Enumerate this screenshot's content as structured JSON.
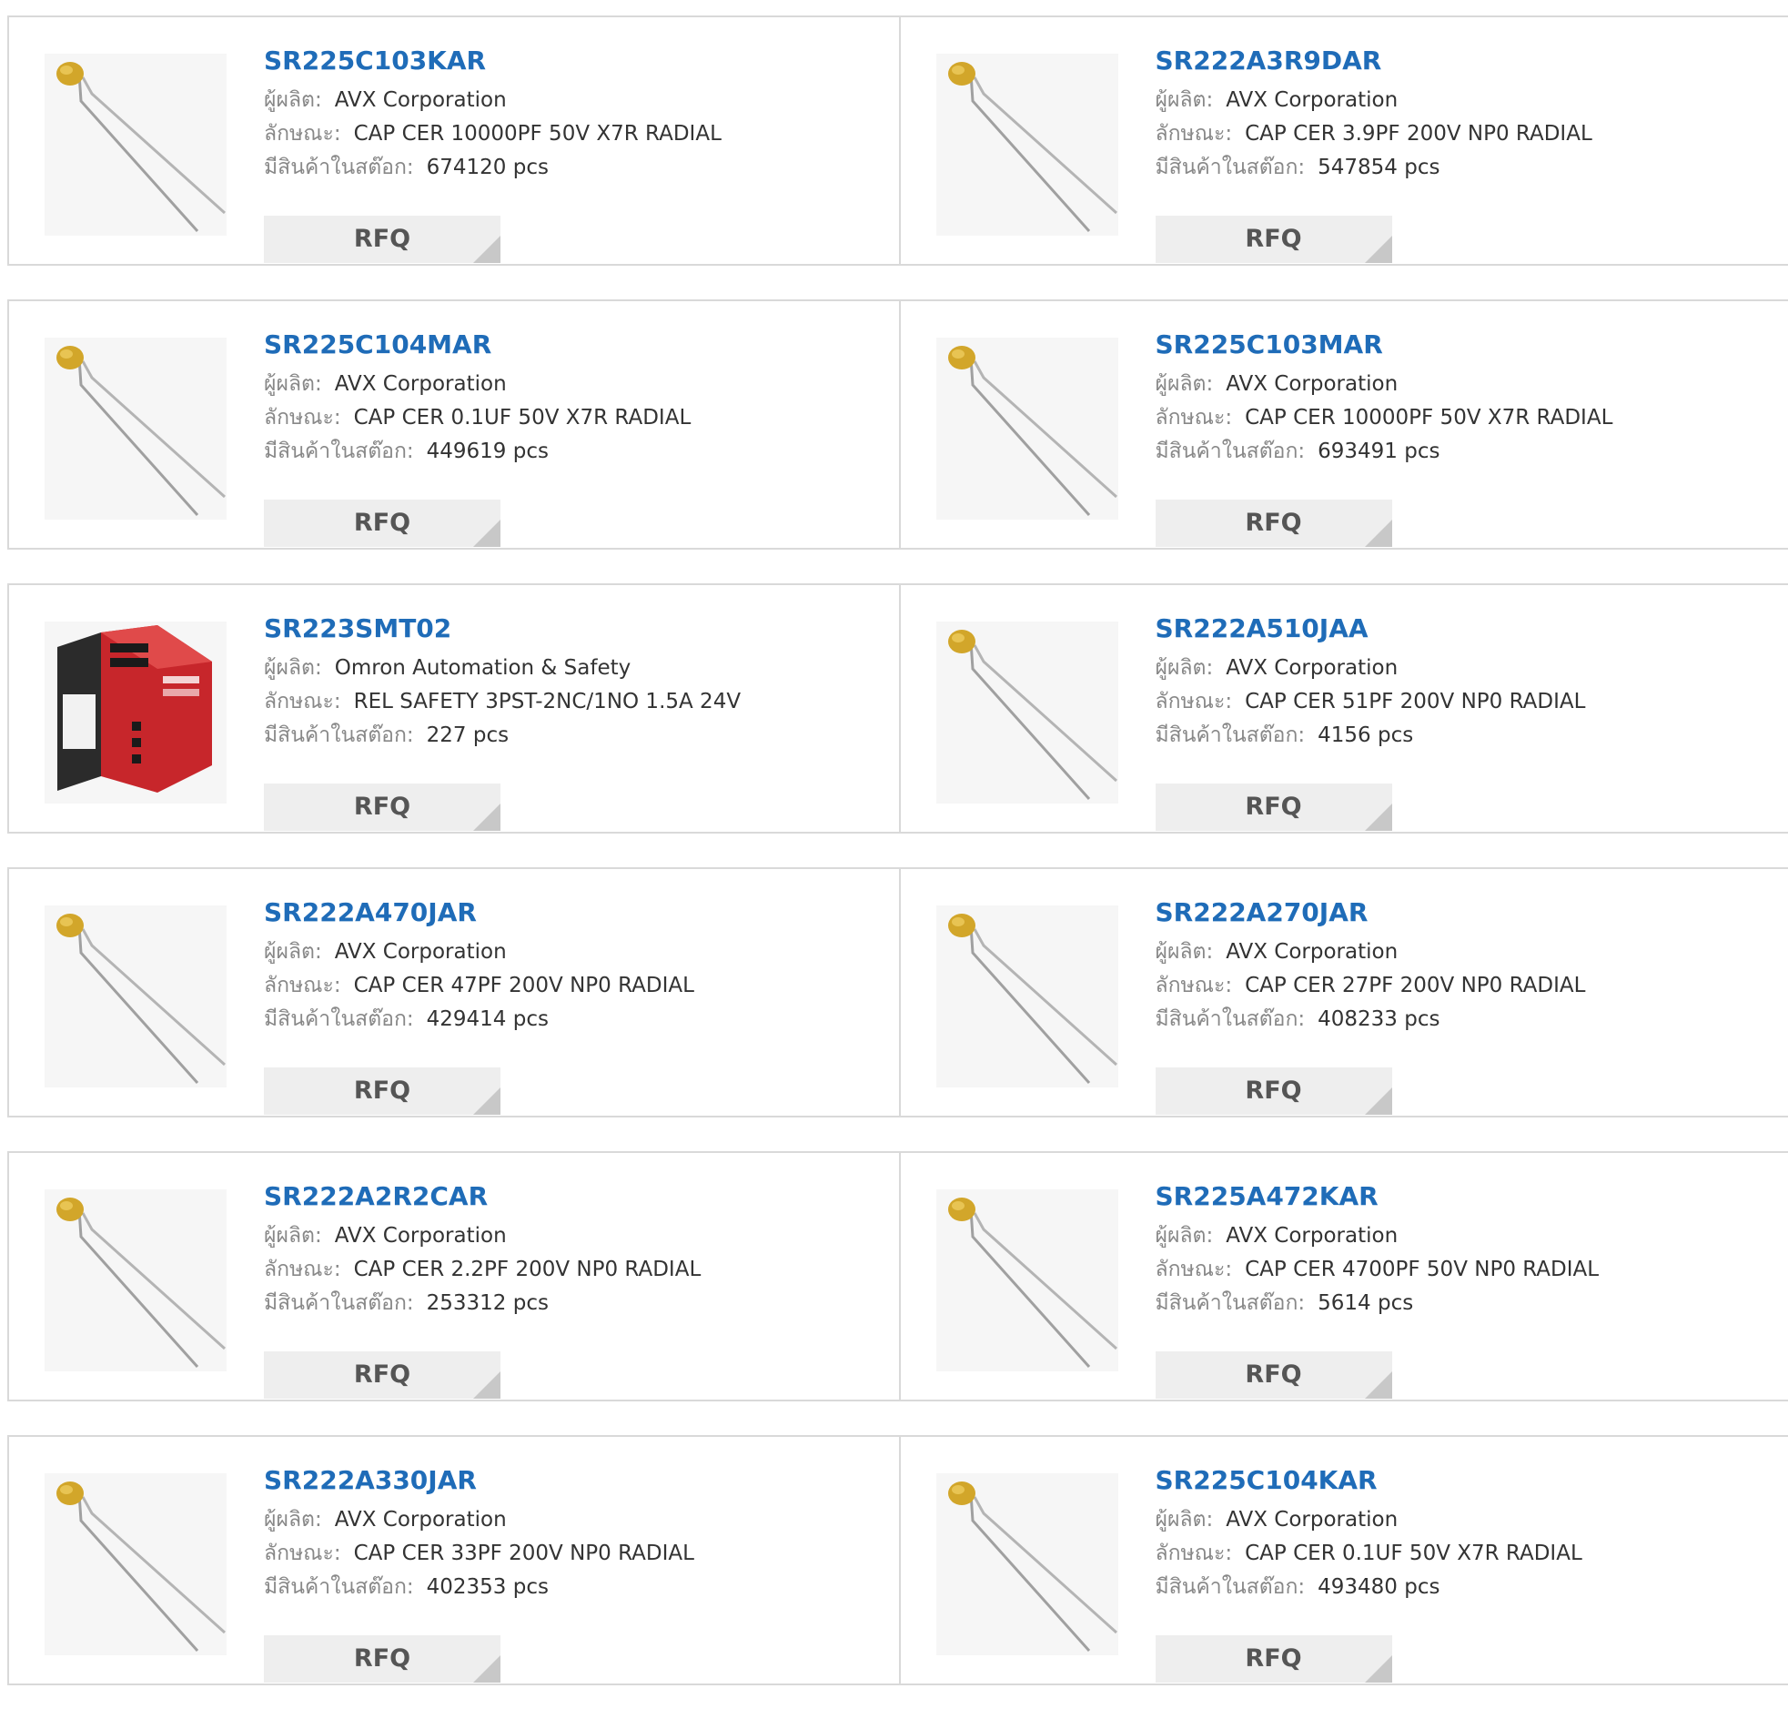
{
  "labels": {
    "manufacturer": "ผู้ผลิต:",
    "description": "ลักษณะ:",
    "stock": "มีสินค้าในสต๊อก:",
    "rfq": "RFQ"
  },
  "products": [
    {
      "part": "SR225C103KAR",
      "manufacturer": "AVX Corporation",
      "description": "CAP CER 10000PF 50V X7R RADIAL",
      "stock": "674120 pcs",
      "image": "radial-capacitor-icon"
    },
    {
      "part": "SR222A3R9DAR",
      "manufacturer": "AVX Corporation",
      "description": "CAP CER 3.9PF 200V NP0 RADIAL",
      "stock": "547854 pcs",
      "image": "radial-capacitor-icon"
    },
    {
      "part": "SR225C104MAR",
      "manufacturer": "AVX Corporation",
      "description": "CAP CER 0.1UF 50V X7R RADIAL",
      "stock": "449619 pcs",
      "image": "radial-capacitor-icon"
    },
    {
      "part": "SR225C103MAR",
      "manufacturer": "AVX Corporation",
      "description": "CAP CER 10000PF 50V X7R RADIAL",
      "stock": "693491 pcs",
      "image": "radial-capacitor-icon"
    },
    {
      "part": "SR223SMT02",
      "manufacturer": "Omron Automation & Safety",
      "description": "REL SAFETY 3PST-2NC/1NO 1.5A 24V",
      "stock": "227 pcs",
      "image": "safety-relay-icon"
    },
    {
      "part": "SR222A510JAA",
      "manufacturer": "AVX Corporation",
      "description": "CAP CER 51PF 200V NP0 RADIAL",
      "stock": "4156 pcs",
      "image": "radial-capacitor-icon"
    },
    {
      "part": "SR222A470JAR",
      "manufacturer": "AVX Corporation",
      "description": "CAP CER 47PF 200V NP0 RADIAL",
      "stock": "429414 pcs",
      "image": "radial-capacitor-icon"
    },
    {
      "part": "SR222A270JAR",
      "manufacturer": "AVX Corporation",
      "description": "CAP CER 27PF 200V NP0 RADIAL",
      "stock": "408233 pcs",
      "image": "radial-capacitor-icon"
    },
    {
      "part": "SR222A2R2CAR",
      "manufacturer": "AVX Corporation",
      "description": "CAP CER 2.2PF 200V NP0 RADIAL",
      "stock": "253312 pcs",
      "image": "radial-capacitor-icon"
    },
    {
      "part": "SR225A472KAR",
      "manufacturer": "AVX Corporation",
      "description": "CAP CER 4700PF 50V NP0 RADIAL",
      "stock": "5614 pcs",
      "image": "radial-capacitor-icon"
    },
    {
      "part": "SR222A330JAR",
      "manufacturer": "AVX Corporation",
      "description": "CAP CER 33PF 200V NP0 RADIAL",
      "stock": "402353 pcs",
      "image": "radial-capacitor-icon"
    },
    {
      "part": "SR225C104KAR",
      "manufacturer": "AVX Corporation",
      "description": "CAP CER 0.1UF 50V X7R RADIAL",
      "stock": "493480 pcs",
      "image": "radial-capacitor-icon"
    }
  ],
  "colors": {
    "part_link": "#1f6cb8",
    "label": "#888888",
    "value": "#333333",
    "rfq_bg": "#eeeeee",
    "border": "#d9d9d9"
  }
}
